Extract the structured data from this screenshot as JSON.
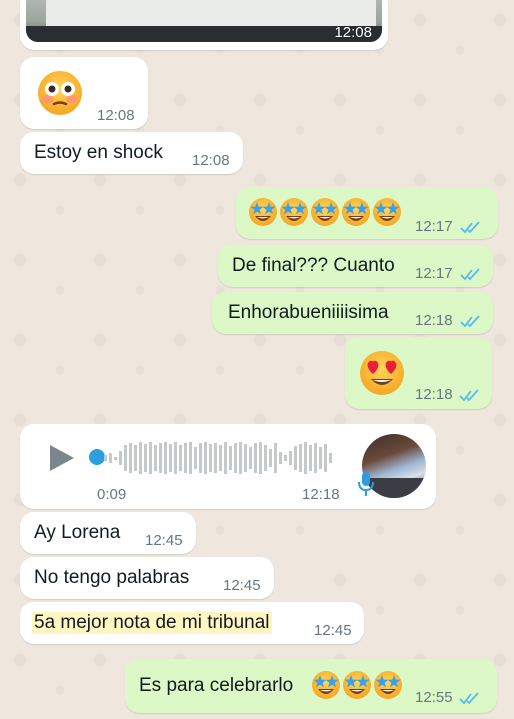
{
  "messages": {
    "image_msg": {
      "time": "12:08"
    },
    "m1": {
      "emoji": "flushed-face",
      "time": "12:08"
    },
    "m2": {
      "text": "Estoy en shock",
      "time": "12:08"
    },
    "m3": {
      "emoji": "star-struck x5",
      "time": "12:17",
      "status": "read"
    },
    "m4": {
      "text": "De final??? Cuanto",
      "time": "12:17",
      "status": "read"
    },
    "m5": {
      "text": "Enhorabueniiiisima",
      "time": "12:18",
      "status": "read"
    },
    "m6": {
      "emoji": "heart-eyes",
      "time": "12:18",
      "status": "read"
    },
    "voice": {
      "duration": "0:09",
      "time": "12:18"
    },
    "m7": {
      "text": "Ay Lorena",
      "time": "12:45"
    },
    "m8": {
      "text": "No tengo palabras",
      "time": "12:45"
    },
    "m9": {
      "text": "5a mejor nota de mi tribunal",
      "time": "12:45"
    },
    "m10": {
      "text": "Es para celebrarlo",
      "emoji": "star-struck x3",
      "time": "12:55",
      "status": "read"
    }
  },
  "colors": {
    "incoming_bubble": "#ffffff",
    "outgoing_bubble": "#dcf8c6",
    "read_ticks": "#53bdeb",
    "time_text": "#667781",
    "voice_accent": "#2c9de0"
  }
}
